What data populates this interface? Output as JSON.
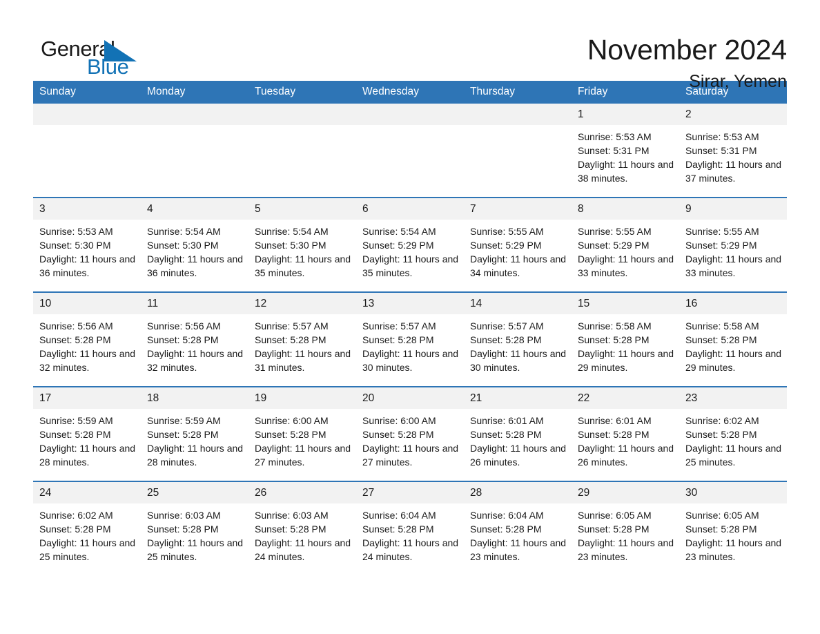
{
  "brand": {
    "name_part1": "General",
    "name_part2": "Blue",
    "flag_icon": "triangle-flag-icon",
    "accent_color": "#1272b5"
  },
  "header": {
    "title": "November 2024",
    "location": "Sirar, Yemen"
  },
  "calendar": {
    "header_bg": "#2e75b6",
    "daynum_bg": "#f2f2f2",
    "weekday_headers": [
      "Sunday",
      "Monday",
      "Tuesday",
      "Wednesday",
      "Thursday",
      "Friday",
      "Saturday"
    ],
    "weeks": [
      [
        {
          "day": "",
          "empty": true
        },
        {
          "day": "",
          "empty": true
        },
        {
          "day": "",
          "empty": true
        },
        {
          "day": "",
          "empty": true
        },
        {
          "day": "",
          "empty": true
        },
        {
          "day": "1",
          "sunrise": "Sunrise: 5:53 AM",
          "sunset": "Sunset: 5:31 PM",
          "daylight": "Daylight: 11 hours and 38 minutes."
        },
        {
          "day": "2",
          "sunrise": "Sunrise: 5:53 AM",
          "sunset": "Sunset: 5:31 PM",
          "daylight": "Daylight: 11 hours and 37 minutes."
        }
      ],
      [
        {
          "day": "3",
          "sunrise": "Sunrise: 5:53 AM",
          "sunset": "Sunset: 5:30 PM",
          "daylight": "Daylight: 11 hours and 36 minutes."
        },
        {
          "day": "4",
          "sunrise": "Sunrise: 5:54 AM",
          "sunset": "Sunset: 5:30 PM",
          "daylight": "Daylight: 11 hours and 36 minutes."
        },
        {
          "day": "5",
          "sunrise": "Sunrise: 5:54 AM",
          "sunset": "Sunset: 5:30 PM",
          "daylight": "Daylight: 11 hours and 35 minutes."
        },
        {
          "day": "6",
          "sunrise": "Sunrise: 5:54 AM",
          "sunset": "Sunset: 5:29 PM",
          "daylight": "Daylight: 11 hours and 35 minutes."
        },
        {
          "day": "7",
          "sunrise": "Sunrise: 5:55 AM",
          "sunset": "Sunset: 5:29 PM",
          "daylight": "Daylight: 11 hours and 34 minutes."
        },
        {
          "day": "8",
          "sunrise": "Sunrise: 5:55 AM",
          "sunset": "Sunset: 5:29 PM",
          "daylight": "Daylight: 11 hours and 33 minutes."
        },
        {
          "day": "9",
          "sunrise": "Sunrise: 5:55 AM",
          "sunset": "Sunset: 5:29 PM",
          "daylight": "Daylight: 11 hours and 33 minutes."
        }
      ],
      [
        {
          "day": "10",
          "sunrise": "Sunrise: 5:56 AM",
          "sunset": "Sunset: 5:28 PM",
          "daylight": "Daylight: 11 hours and 32 minutes."
        },
        {
          "day": "11",
          "sunrise": "Sunrise: 5:56 AM",
          "sunset": "Sunset: 5:28 PM",
          "daylight": "Daylight: 11 hours and 32 minutes."
        },
        {
          "day": "12",
          "sunrise": "Sunrise: 5:57 AM",
          "sunset": "Sunset: 5:28 PM",
          "daylight": "Daylight: 11 hours and 31 minutes."
        },
        {
          "day": "13",
          "sunrise": "Sunrise: 5:57 AM",
          "sunset": "Sunset: 5:28 PM",
          "daylight": "Daylight: 11 hours and 30 minutes."
        },
        {
          "day": "14",
          "sunrise": "Sunrise: 5:57 AM",
          "sunset": "Sunset: 5:28 PM",
          "daylight": "Daylight: 11 hours and 30 minutes."
        },
        {
          "day": "15",
          "sunrise": "Sunrise: 5:58 AM",
          "sunset": "Sunset: 5:28 PM",
          "daylight": "Daylight: 11 hours and 29 minutes."
        },
        {
          "day": "16",
          "sunrise": "Sunrise: 5:58 AM",
          "sunset": "Sunset: 5:28 PM",
          "daylight": "Daylight: 11 hours and 29 minutes."
        }
      ],
      [
        {
          "day": "17",
          "sunrise": "Sunrise: 5:59 AM",
          "sunset": "Sunset: 5:28 PM",
          "daylight": "Daylight: 11 hours and 28 minutes."
        },
        {
          "day": "18",
          "sunrise": "Sunrise: 5:59 AM",
          "sunset": "Sunset: 5:28 PM",
          "daylight": "Daylight: 11 hours and 28 minutes."
        },
        {
          "day": "19",
          "sunrise": "Sunrise: 6:00 AM",
          "sunset": "Sunset: 5:28 PM",
          "daylight": "Daylight: 11 hours and 27 minutes."
        },
        {
          "day": "20",
          "sunrise": "Sunrise: 6:00 AM",
          "sunset": "Sunset: 5:28 PM",
          "daylight": "Daylight: 11 hours and 27 minutes."
        },
        {
          "day": "21",
          "sunrise": "Sunrise: 6:01 AM",
          "sunset": "Sunset: 5:28 PM",
          "daylight": "Daylight: 11 hours and 26 minutes."
        },
        {
          "day": "22",
          "sunrise": "Sunrise: 6:01 AM",
          "sunset": "Sunset: 5:28 PM",
          "daylight": "Daylight: 11 hours and 26 minutes."
        },
        {
          "day": "23",
          "sunrise": "Sunrise: 6:02 AM",
          "sunset": "Sunset: 5:28 PM",
          "daylight": "Daylight: 11 hours and 25 minutes."
        }
      ],
      [
        {
          "day": "24",
          "sunrise": "Sunrise: 6:02 AM",
          "sunset": "Sunset: 5:28 PM",
          "daylight": "Daylight: 11 hours and 25 minutes."
        },
        {
          "day": "25",
          "sunrise": "Sunrise: 6:03 AM",
          "sunset": "Sunset: 5:28 PM",
          "daylight": "Daylight: 11 hours and 25 minutes."
        },
        {
          "day": "26",
          "sunrise": "Sunrise: 6:03 AM",
          "sunset": "Sunset: 5:28 PM",
          "daylight": "Daylight: 11 hours and 24 minutes."
        },
        {
          "day": "27",
          "sunrise": "Sunrise: 6:04 AM",
          "sunset": "Sunset: 5:28 PM",
          "daylight": "Daylight: 11 hours and 24 minutes."
        },
        {
          "day": "28",
          "sunrise": "Sunrise: 6:04 AM",
          "sunset": "Sunset: 5:28 PM",
          "daylight": "Daylight: 11 hours and 23 minutes."
        },
        {
          "day": "29",
          "sunrise": "Sunrise: 6:05 AM",
          "sunset": "Sunset: 5:28 PM",
          "daylight": "Daylight: 11 hours and 23 minutes."
        },
        {
          "day": "30",
          "sunrise": "Sunrise: 6:05 AM",
          "sunset": "Sunset: 5:28 PM",
          "daylight": "Daylight: 11 hours and 23 minutes."
        }
      ]
    ]
  }
}
